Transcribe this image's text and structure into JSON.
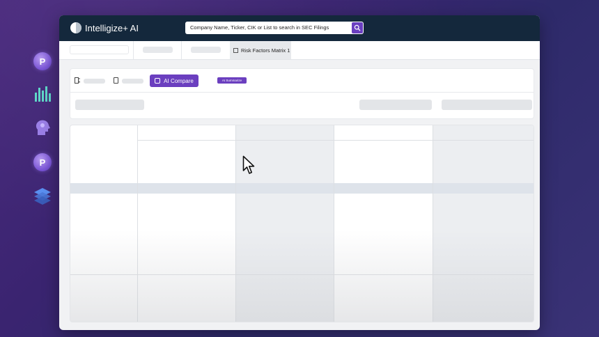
{
  "app": {
    "brand": "Intelligize+ AI"
  },
  "search": {
    "placeholder": "Company Name, Ticker, CIK or List to search in SEC Filings"
  },
  "tabs": {
    "active_label": "Risk Factors Matrix 1"
  },
  "toolbar": {
    "compare_label": "AI Compare",
    "summarize_label": "AI Summarize"
  },
  "rail": {
    "badge_letter": "P"
  },
  "colors": {
    "accent": "#6b3fbf",
    "topbar": "#14283c",
    "background": "#3b2a74"
  }
}
